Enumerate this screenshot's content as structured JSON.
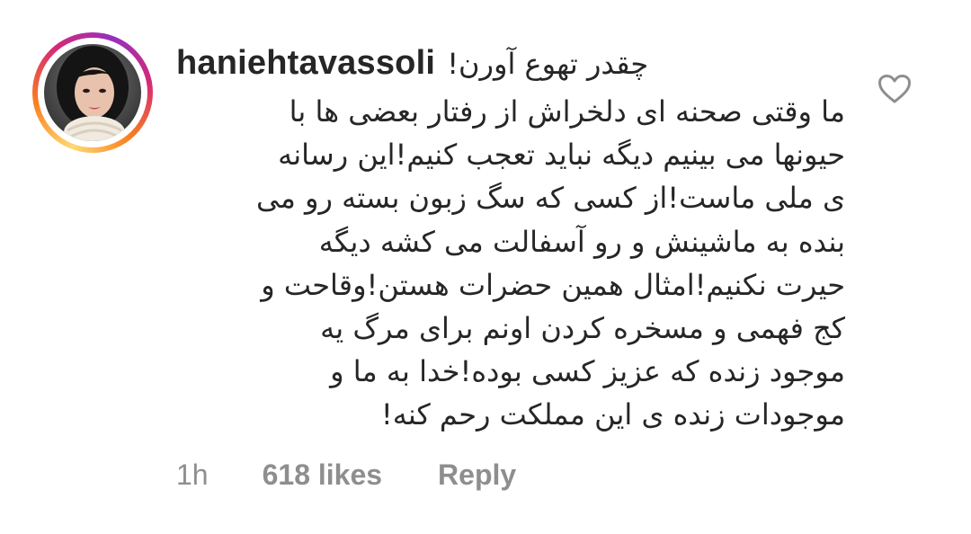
{
  "comment": {
    "username": "haniehtavassoli",
    "first_line": "چقدر تهوع آورن!",
    "body_lines": [
      "ما وقتی صحنه ای دلخراش از رفتار بعضی ها با",
      "حیونها می بینیم دیگه نباید تعجب کنیم!این رسانه",
      "ی ملی ماست!از کسی که سگ زبون بسته رو می",
      "بنده به ماشینش و رو آسفالت می کشه دیگه",
      "حیرت نکنیم!امثال همین حضرات هستن!وقاحت و",
      "کج فهمی و مسخره کردن اونم برای مرگ یه",
      "موجود زنده که عزیز کسی بوده!خدا به ما و",
      "موجودات زنده ی این مملکت رحم کنه!"
    ],
    "time": "1h",
    "likes": "618 likes",
    "reply_label": "Reply"
  },
  "icons": {
    "like": "heart-outline-icon",
    "avatar": "profile-photo"
  },
  "colors": {
    "text": "#262626",
    "meta": "#8e8e8e",
    "icon": "#8e8e8e",
    "story_ring": [
      "#feda75",
      "#fa7e1e",
      "#d62976",
      "#962fbf"
    ]
  }
}
